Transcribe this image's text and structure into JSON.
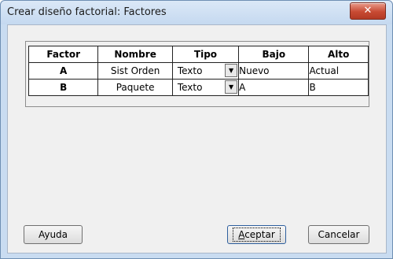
{
  "window": {
    "title": "Crear diseño factorial: Factores",
    "close_icon": "close-icon"
  },
  "grid": {
    "headers": [
      "Factor",
      "Nombre",
      "Tipo",
      "Bajo",
      "Alto"
    ],
    "rows": [
      {
        "factor": "A",
        "nombre": "Sist Orden",
        "tipo": "Texto",
        "bajo": "Nuevo",
        "alto": "Actual"
      },
      {
        "factor": "B",
        "nombre": "Paquete",
        "tipo": "Texto",
        "bajo": "A",
        "alto": "B"
      }
    ]
  },
  "buttons": {
    "help": "Ayuda",
    "ok_access_key": "A",
    "ok_rest": "ceptar",
    "cancel": "Cancelar"
  }
}
